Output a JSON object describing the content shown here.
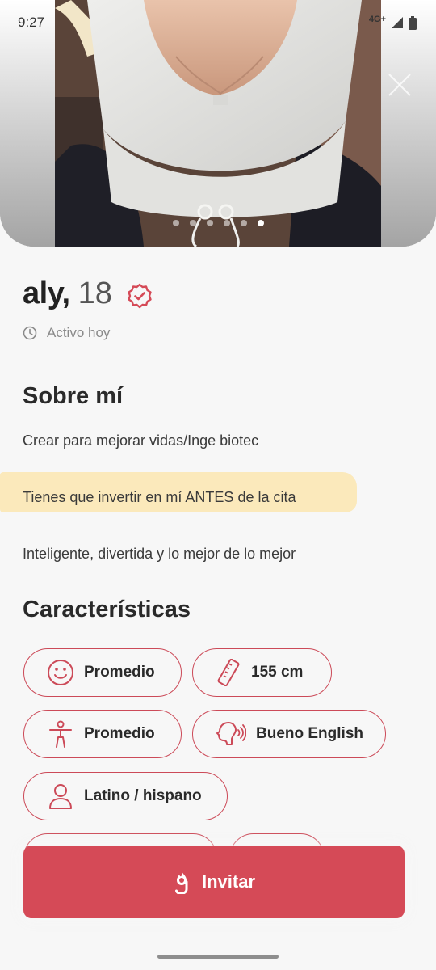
{
  "status_bar": {
    "time": "9:27",
    "network": "4G+"
  },
  "photo": {
    "dots_total": 6,
    "active_dot": 6
  },
  "profile": {
    "name": "aly,",
    "age": "18",
    "activity": "Activo hoy"
  },
  "about": {
    "title": "Sobre mí",
    "lines": [
      "Crear para mejorar vidas/Inge biotec",
      "Tienes que invertir en mí ANTES de la cita",
      "Inteligente, divertida y lo mejor de lo mejor"
    ]
  },
  "characteristics": {
    "title": "Características",
    "chips": [
      {
        "icon": "smile-icon",
        "label": "Promedio"
      },
      {
        "icon": "ruler-icon",
        "label": "155 cm"
      },
      {
        "icon": "body-icon",
        "label": "Promedio"
      },
      {
        "icon": "speech-icon",
        "label": "Bueno English"
      },
      {
        "icon": "person-icon",
        "label": "Latino / hispano"
      }
    ]
  },
  "cta": {
    "invite_label": "Invitar"
  },
  "colors": {
    "accent": "#d54a57",
    "chip_border": "#cc4a58",
    "highlight": "#fbe7b4",
    "background": "#f7f7f7"
  }
}
